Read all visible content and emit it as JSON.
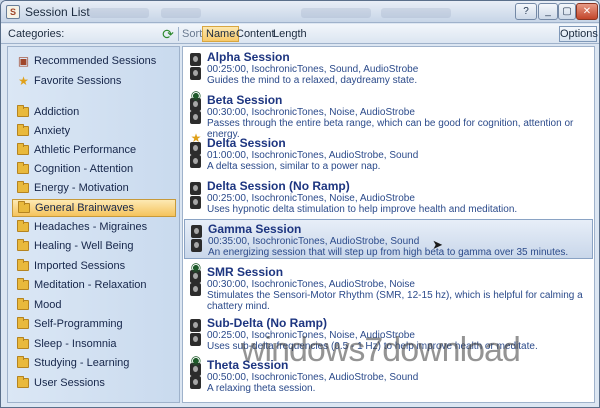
{
  "window": {
    "title": "Session List"
  },
  "toolbar": {
    "categories_label": "Categories:",
    "sort_label": "Sort:",
    "sort_options": [
      "Name",
      "Content",
      "Length"
    ],
    "active_sort": "Name",
    "options_label": "Options"
  },
  "sidebar": {
    "top_items": [
      {
        "label": "Recommended Sessions",
        "icon": "recommended-icon"
      },
      {
        "label": "Favorite Sessions",
        "icon": "star-icon"
      }
    ],
    "categories": [
      "Addiction",
      "Anxiety",
      "Athletic Performance",
      "Cognition - Attention",
      "Energy - Motivation",
      "General Brainwaves",
      "Headaches - Migraines",
      "Healing - Well Being",
      "Imported Sessions",
      "Meditation - Relaxation",
      "Mood",
      "Self-Programming",
      "Sleep - Insomnia",
      "Studying - Learning",
      "User Sessions"
    ],
    "selected": "General Brainwaves"
  },
  "sessions": [
    {
      "name": "Alpha Session",
      "meta": "00:25:00, IsochronicTones, Sound, AudioStrobe",
      "description": "Guides the mind to a relaxed, daydreamy state.",
      "overlay": ""
    },
    {
      "name": "Beta Session",
      "meta": "00:30:00, IsochronicTones, Noise, AudioStrobe",
      "description": "Passes through the entire beta range, which can be good for cognition, attention or energy.",
      "overlay": "eye-icon"
    },
    {
      "name": "Delta Session",
      "meta": "01:00:00, IsochronicTones, AudioStrobe, Sound",
      "description": "A delta session, similar to a power nap.",
      "overlay": "star-icon"
    },
    {
      "name": "Delta Session (No Ramp)",
      "meta": "00:25:00, IsochronicTones, Noise, AudioStrobe",
      "description": "Uses hypnotic delta stimulation to help improve health and meditation.",
      "overlay": ""
    },
    {
      "name": "Gamma Session",
      "meta": "00:35:00, IsochronicTones, AudioStrobe, Sound",
      "description": "An energizing session that will step up from high beta to gamma over 35 minutes.",
      "overlay": ""
    },
    {
      "name": "SMR Session",
      "meta": "00:30:00, IsochronicTones, AudioStrobe, Noise",
      "description": "Stimulates the Sensori-Motor Rhythm (SMR, 12-15 hz), which is helpful for calming a chattery mind.",
      "overlay": "eye-icon"
    },
    {
      "name": "Sub-Delta (No Ramp)",
      "meta": "00:25:00, IsochronicTones, Noise, AudioStrobe",
      "description": "Uses sub-delta frequencies (0.5 - 1 Hz) to help improve health or meditate.",
      "overlay": ""
    },
    {
      "name": "Theta Session",
      "meta": "00:50:00, IsochronicTones, AudioStrobe, Sound",
      "description": "A relaxing theta session.",
      "overlay": "eye-icon"
    }
  ],
  "selected_session": "Gamma Session",
  "watermark": "windows7download"
}
